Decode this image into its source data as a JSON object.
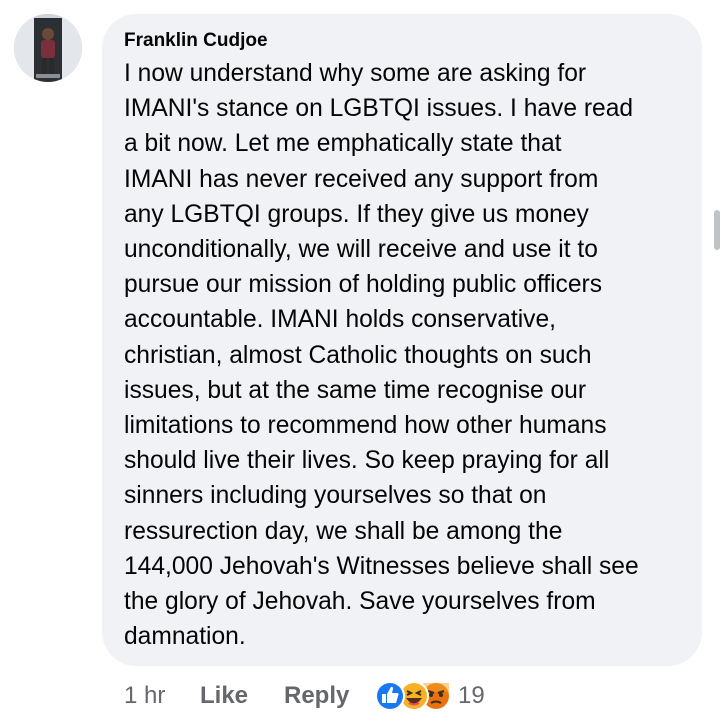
{
  "comment": {
    "author": "Franklin Cudjoe",
    "text": "I now understand why some are asking for\nIMANI's stance on LGBTQI issues. I have read\na bit now.  Let me emphatically state that\nIMANI has never received any support from\nany LGBTQI groups. If they give us money\nunconditionally, we will receive and use it to\npursue our mission of holding public officers\naccountable.  IMANI holds conservative,\nchristian,  almost Catholic thoughts on such\nissues, but at the same time recognise our\nlimitations to recommend how other humans\nshould live their lives. So keep praying for all\nsinners including yourselves so that on\nressurection day, we shall be among the\n144,000  Jehovah's Witnesses believe shall see\nthe glory of Jehovah. Save yourselves from\ndamnation."
  },
  "footer": {
    "time": "1 hr",
    "like_label": "Like",
    "reply_label": "Reply",
    "reaction_count": "19",
    "reactions": [
      "like-reaction-icon",
      "haha-reaction-icon",
      "angry-reaction-icon"
    ]
  },
  "colors": {
    "bubble": "#f0f2f5",
    "text": "#050505",
    "secondary": "#65676b",
    "like_blue": "#1877f2",
    "haha_yellow": "#f7b125",
    "angry_red": "#e9710f"
  }
}
